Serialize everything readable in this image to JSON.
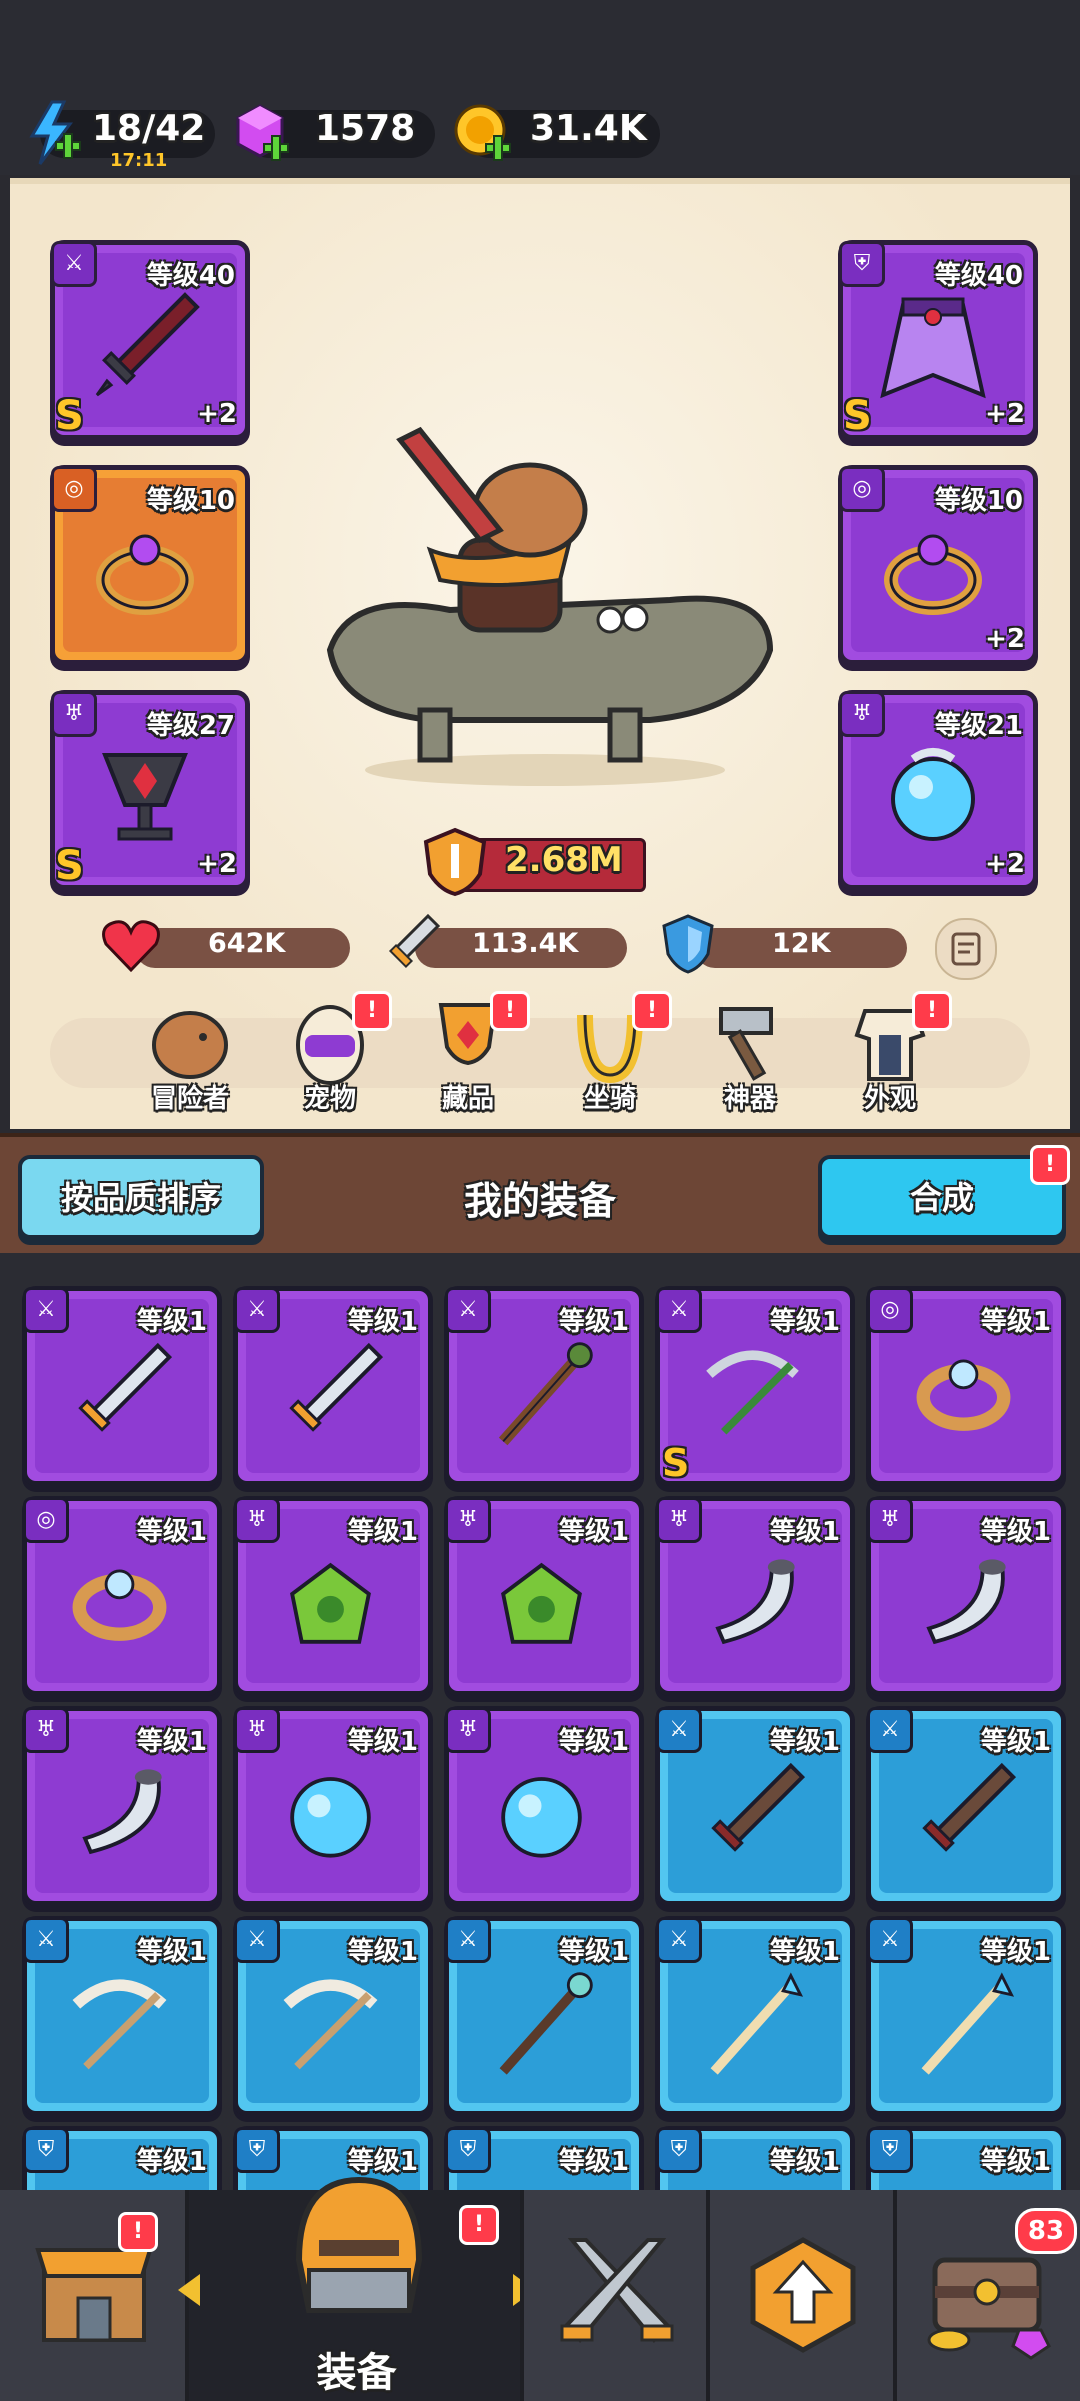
{
  "status": {
    "energy": "18/42",
    "energy_timer": "17:11",
    "gems": "1578",
    "gold": "31.4K"
  },
  "hero": {
    "power": "2.68M",
    "hp": "642K",
    "atk": "113.4K",
    "def": "12K",
    "slots": [
      {
        "level": "等级40",
        "plus": "+2",
        "grade": "S"
      },
      {
        "level": "等级10",
        "plus": "",
        "grade": ""
      },
      {
        "level": "等级27",
        "plus": "+2",
        "grade": "S"
      },
      {
        "level": "等级40",
        "plus": "+2",
        "grade": "S"
      },
      {
        "level": "等级10",
        "plus": "+2",
        "grade": ""
      },
      {
        "level": "等级21",
        "plus": "+2",
        "grade": ""
      }
    ],
    "menu": [
      "冒险者",
      "宠物",
      "藏品",
      "坐骑",
      "神器",
      "外观"
    ],
    "badge_mark": "!"
  },
  "equipment": {
    "sort_button": "按品质排序",
    "title": "我的装备",
    "merge_button": "合成",
    "items": [
      {
        "level": "等级1",
        "grade": ""
      },
      {
        "level": "等级1",
        "grade": ""
      },
      {
        "level": "等级1",
        "grade": ""
      },
      {
        "level": "等级1",
        "grade": "S"
      },
      {
        "level": "等级1",
        "grade": ""
      },
      {
        "level": "等级1",
        "grade": ""
      },
      {
        "level": "等级1",
        "grade": ""
      },
      {
        "level": "等级1",
        "grade": ""
      },
      {
        "level": "等级1",
        "grade": ""
      },
      {
        "level": "等级1",
        "grade": ""
      },
      {
        "level": "等级1",
        "grade": ""
      },
      {
        "level": "等级1",
        "grade": ""
      },
      {
        "level": "等级1",
        "grade": ""
      },
      {
        "level": "等级1",
        "grade": ""
      },
      {
        "level": "等级1",
        "grade": ""
      },
      {
        "level": "等级1",
        "grade": ""
      },
      {
        "level": "等级1",
        "grade": ""
      },
      {
        "level": "等级1",
        "grade": ""
      },
      {
        "level": "等级1",
        "grade": ""
      },
      {
        "level": "等级1",
        "grade": ""
      },
      {
        "level": "等级1",
        "grade": ""
      },
      {
        "level": "等级1",
        "grade": ""
      },
      {
        "level": "等级1",
        "grade": ""
      },
      {
        "level": "等级1",
        "grade": ""
      },
      {
        "level": "等级1",
        "grade": ""
      }
    ]
  },
  "nav": {
    "active_label": "装备",
    "chest_count": "83",
    "badge_mark": "!"
  },
  "colors": {
    "purple_rarity": "#a14ce0",
    "blue_rarity": "#52c6f0",
    "orange_rarity": "#f6a037",
    "accent_cyan": "#2ec7f0"
  }
}
